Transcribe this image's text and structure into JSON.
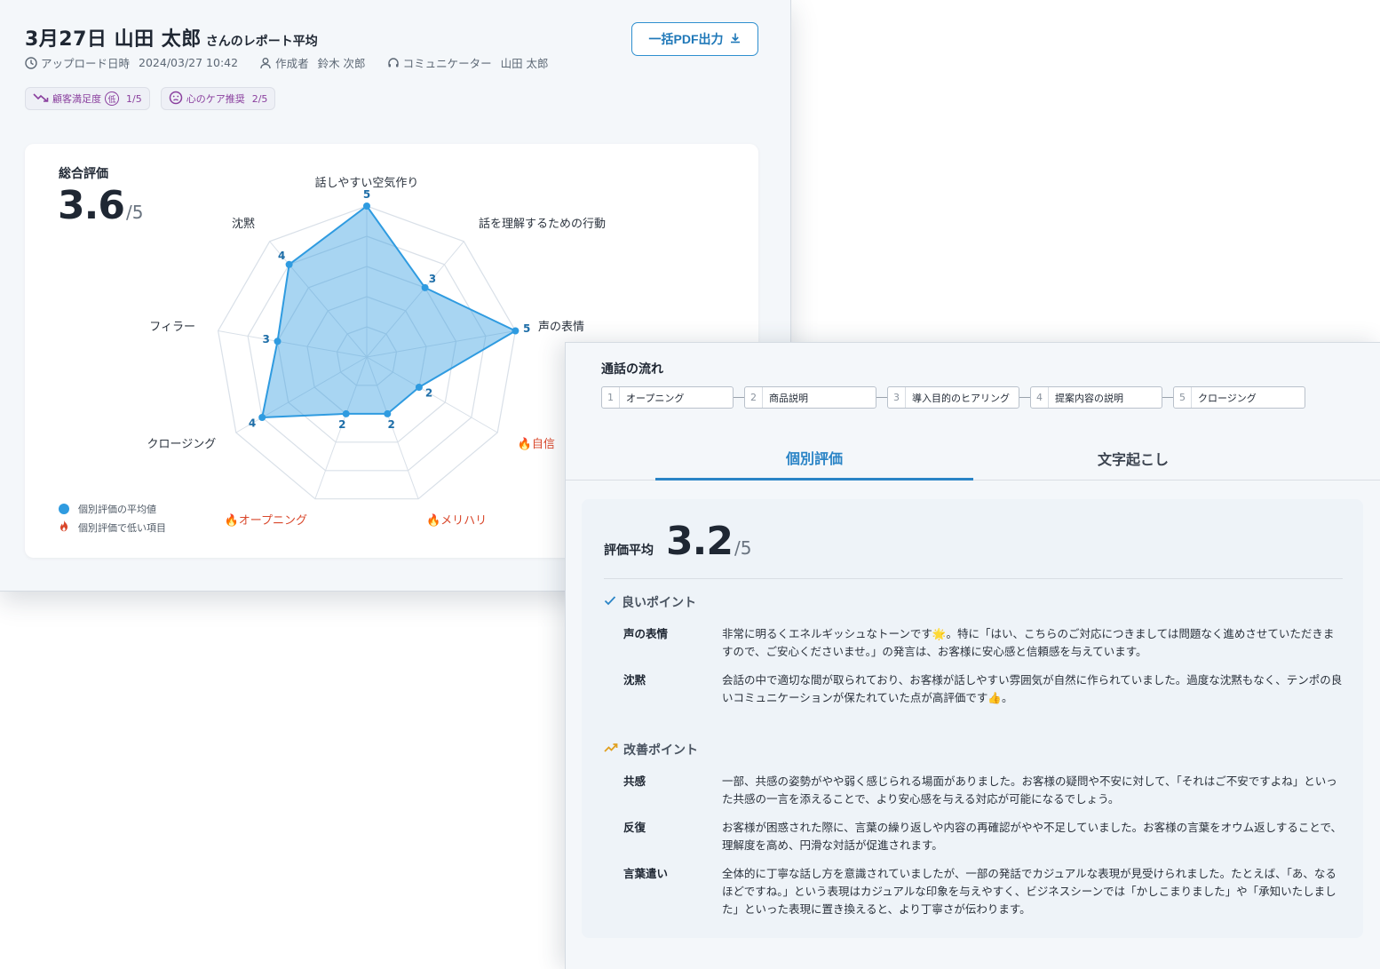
{
  "report": {
    "title_main": "3月27日 山田 太郎",
    "title_sub": "さんのレポート平均",
    "upload_label": "アップロード日時",
    "upload_value": "2024/03/27 10:42",
    "author_label": "作成者",
    "author_value": "鈴木 次郎",
    "communicator_label": "コミュニケーター",
    "communicator_value": "山田 太郎",
    "pdf_button": "一括PDF出力",
    "tags": [
      {
        "label": "顧客満足度",
        "badge": "低",
        "score": "1/5",
        "icon": "trend-down-icon"
      },
      {
        "label": "心のケア推奨",
        "score": "2/5",
        "icon": "face-icon"
      }
    ]
  },
  "overall": {
    "label": "総合評価",
    "score": "3.6",
    "denominator": "/5"
  },
  "chart_data": {
    "type": "radar",
    "max": 5,
    "levels": 5,
    "axes": [
      {
        "label": "話しやすい空気作り",
        "value": 5,
        "low": false
      },
      {
        "label": "話を理解するための行動",
        "value": 3,
        "low": false
      },
      {
        "label": "声の表情",
        "value": 5,
        "low": false
      },
      {
        "label": "自信",
        "value": 2,
        "low": true
      },
      {
        "label": "メリハリ",
        "value": 2,
        "low": true
      },
      {
        "label": "オープニング",
        "value": 2,
        "low": true
      },
      {
        "label": "クロージング",
        "value": 4,
        "low": false
      },
      {
        "label": "フィラー",
        "value": 3,
        "low": false
      },
      {
        "label": "沈黙",
        "value": 4,
        "low": false
      }
    ],
    "colors": {
      "fill": "#2f9be0",
      "stroke": "#2f9be0",
      "grid": "#d9e0e8",
      "low": "#d9472b"
    },
    "legend": [
      {
        "label": "個別評価の平均値",
        "icon": "blue-dot"
      },
      {
        "label": "個別評価で低い項目",
        "icon": "flame-icon"
      }
    ]
  },
  "flow": {
    "title": "通話の流れ",
    "steps": [
      {
        "num": "1",
        "label": "オープニング"
      },
      {
        "num": "2",
        "label": "商品説明"
      },
      {
        "num": "3",
        "label": "導入目的のヒアリング"
      },
      {
        "num": "4",
        "label": "提案内容の説明"
      },
      {
        "num": "5",
        "label": "クロージング"
      }
    ]
  },
  "tabs": {
    "active": "個別評価",
    "inactive": "文字起こし"
  },
  "evaluation": {
    "avg_label": "評価平均",
    "avg_score": "3.2",
    "avg_denominator": "/5",
    "good_title": "良いポイント",
    "good_points": [
      {
        "name": "声の表情",
        "text": "非常に明るくエネルギッシュなトーンです🌟。特に「はい、こちらのご対応につきましては問題なく進めさせていただきますので、ご安心くださいませ。」の発言は、お客様に安心感と信頼感を与えています。"
      },
      {
        "name": "沈黙",
        "text": "会話の中で適切な間が取られており、お客様が話しやすい雰囲気が自然に作られていました。過度な沈黙もなく、テンポの良いコミュニケーションが保たれていた点が高評価です👍。"
      }
    ],
    "improve_title": "改善ポイント",
    "improve_points": [
      {
        "name": "共感",
        "text": "一部、共感の姿勢がやや弱く感じられる場面がありました。お客様の疑問や不安に対して、「それはご不安ですよね」といった共感の一言を添えることで、より安心感を与える対応が可能になるでしょう。"
      },
      {
        "name": "反復",
        "text": "お客様が困惑された際に、言葉の繰り返しや内容の再確認がやや不足していました。お客様の言葉をオウム返しすることで、理解度を高め、円滑な対話が促進されます。"
      },
      {
        "name": "言葉遣い",
        "text": "全体的に丁寧な話し方を意識されていましたが、一部の発話でカジュアルな表現が見受けられました。たとえば、「あ、なるほどですね。」という表現はカジュアルな印象を与えやすく、ビジネスシーンでは「かしこまりました」や「承知いたしました」といった表現に置き換えると、より丁寧さが伝わります。"
      }
    ]
  }
}
